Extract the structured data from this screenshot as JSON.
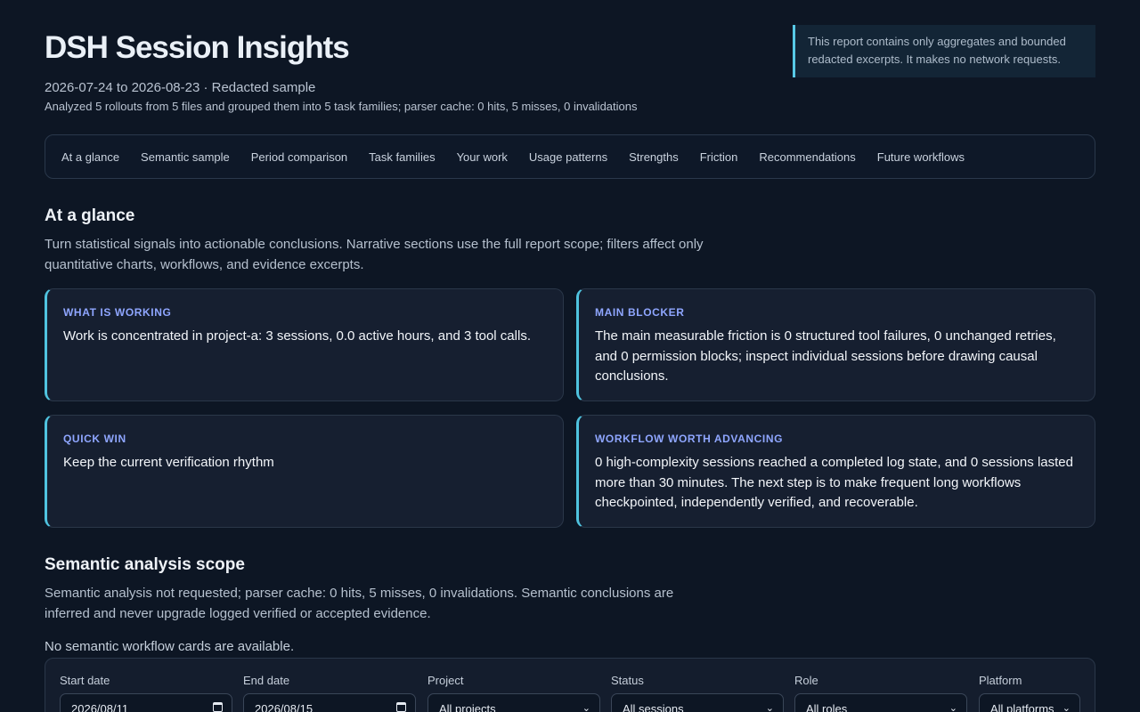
{
  "header": {
    "title": "DSH Session Insights",
    "date_range": "2026-07-24 to 2026-08-23 · Redacted sample",
    "summary": "Analyzed 5 rollouts from 5 files and grouped them into 5 task families; parser cache: 0 hits, 5 misses, 0 invalidations",
    "notice": "This report contains only aggregates and bounded redacted excerpts. It makes no network requests."
  },
  "nav": {
    "items": [
      "At a glance",
      "Semantic sample",
      "Period comparison",
      "Task families",
      "Your work",
      "Usage patterns",
      "Strengths",
      "Friction",
      "Recommendations",
      "Future workflows"
    ]
  },
  "at_a_glance": {
    "title": "At a glance",
    "description": "Turn statistical signals into actionable conclusions. Narrative sections use the full report scope; filters affect only quantitative charts, workflows, and evidence excerpts.",
    "cards": [
      {
        "label": "WHAT IS WORKING",
        "text": "Work is concentrated in project-a: 3 sessions, 0.0 active hours, and 3 tool calls."
      },
      {
        "label": "MAIN BLOCKER",
        "text": "The main measurable friction is 0 structured tool failures, 0 unchanged retries, and 0 permission blocks; inspect individual sessions before drawing causal conclusions."
      },
      {
        "label": "QUICK WIN",
        "text": "Keep the current verification rhythm"
      },
      {
        "label": "WORKFLOW WORTH ADVANCING",
        "text": "0 high-complexity sessions reached a completed log state, and 0 sessions lasted more than 30 minutes. The next step is to make frequent long workflows checkpointed, independently verified, and recoverable."
      }
    ]
  },
  "semantic": {
    "title": "Semantic analysis scope",
    "description": "Semantic analysis not requested; parser cache: 0 hits, 5 misses, 0 invalidations. Semantic conclusions are inferred and never upgrade logged verified or accepted evidence.",
    "empty_note": "No semantic workflow cards are available."
  },
  "filters": {
    "start_date": {
      "label": "Start date",
      "value": "2026/08/11",
      "icon": "calendar-icon"
    },
    "end_date": {
      "label": "End date",
      "value": "2026/08/15",
      "icon": "calendar-icon"
    },
    "project": {
      "label": "Project",
      "value": "All projects",
      "icon": "chevron-down-icon"
    },
    "status": {
      "label": "Status",
      "value": "All sessions",
      "icon": "chevron-down-icon"
    },
    "role": {
      "label": "Role",
      "value": "All roles",
      "icon": "chevron-down-icon"
    },
    "platform": {
      "label": "Platform",
      "value": "All platforms",
      "icon": "chevron-down-icon"
    }
  },
  "colors": {
    "background": "#0d1624",
    "card_accent": "#4fc3df",
    "card_label": "#8fa6ff"
  }
}
